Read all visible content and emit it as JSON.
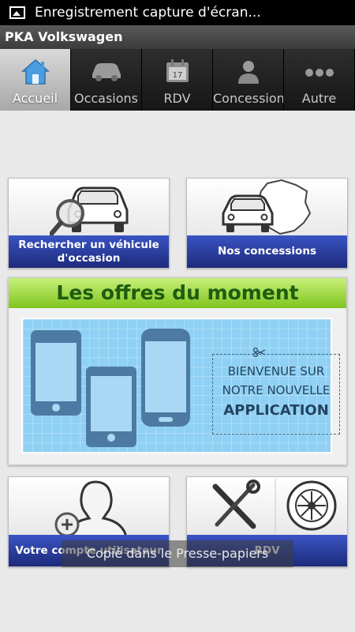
{
  "statusbar": {
    "text": "Enregistrement capture d'écran..."
  },
  "app": {
    "title": "PKA Volkswagen"
  },
  "tabs": [
    {
      "label": "Accueil",
      "icon": "home-icon"
    },
    {
      "label": "Occasions",
      "icon": "car-icon"
    },
    {
      "label": "RDV",
      "icon": "calendar-icon"
    },
    {
      "label": "Concessionnaires",
      "icon": "person-icon"
    },
    {
      "label": "Autre",
      "icon": "more-icon"
    }
  ],
  "calendar_day": "17",
  "cards": {
    "search": {
      "label": "Rechercher un véhicule d'occasion",
      "icon": "car-search-icon"
    },
    "dealers": {
      "label": "Nos concessions",
      "icon": "car-france-map-icon"
    },
    "account": {
      "label": "Votre compte utilisateur",
      "icon": "add-user-icon"
    },
    "rdv": {
      "label": "RDV",
      "icon": "tools-wheel-icon"
    }
  },
  "offers": {
    "title": "Les offres du moment",
    "welcome_line1": "BIENVENUE SUR",
    "welcome_line2": "NOTRE NOUVELLE",
    "welcome_line3": "APPLICATION"
  },
  "toast": {
    "text": "Copié dans le Presse-papiers"
  },
  "colors": {
    "accent_blue": "#2b3fa8",
    "offers_green": "#7fc41e",
    "banner_blue": "#8fd0f4"
  }
}
